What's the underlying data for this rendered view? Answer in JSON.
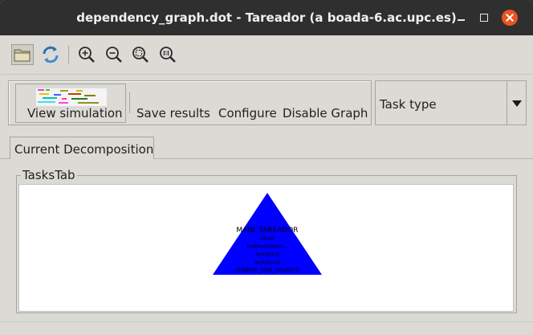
{
  "window": {
    "title": "dependency_graph.dot - Tareador (a boada-6.ac.upc.es)"
  },
  "toolbar": {
    "icons": [
      "open-folder-icon",
      "reload-icon",
      "zoom-in-icon",
      "zoom-out-icon",
      "zoom-fit-icon",
      "zoom-reset-icon"
    ]
  },
  "actions": {
    "view_simulation": "View simulation",
    "save_results": "Save results",
    "configure": "Configure",
    "disable_graph": "Disable Graph"
  },
  "task_type_combo": {
    "selected": "Task type"
  },
  "tabs": [
    {
      "label": "Current Decomposition",
      "active": true
    }
  ],
  "tasks_panel": {
    "label": "TasksTab",
    "node": {
      "lines": [
        "MAIN_TAREADOR",
        "id=0",
        "instructions=..",
        "reads=0",
        "writes=0",
        "children_task_count=0"
      ],
      "fill_color": "#0000ff"
    }
  },
  "colors": {
    "titlebar": "#2f2f2f",
    "window_bg": "#dcdad5",
    "close_button": "#e95420",
    "node_fill": "#0000ff"
  }
}
